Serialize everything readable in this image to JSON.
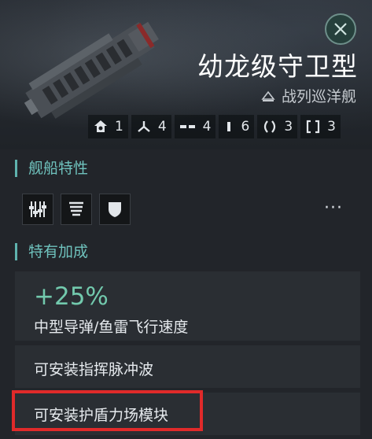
{
  "header": {
    "ship_name": "幼龙级守卫型",
    "ship_class": "战列巡洋舰",
    "close_icon": "close-icon",
    "slots": [
      {
        "icon": "high-slot-icon",
        "value": "1"
      },
      {
        "icon": "turret-icon",
        "value": "4"
      },
      {
        "icon": "launcher-icon",
        "value": "4"
      },
      {
        "icon": "mid-slot-icon",
        "value": "6"
      },
      {
        "icon": "low-slot-icon",
        "value": "3"
      },
      {
        "icon": "rig-slot-icon",
        "value": "3"
      }
    ]
  },
  "traits_section": {
    "title": "舰船特性",
    "traits": [
      "weapons-icon",
      "armor-layers-icon",
      "shield-icon"
    ],
    "more_label": "···"
  },
  "bonus_section": {
    "title": "特有加成",
    "bonus": {
      "percent": "+25%",
      "description": "中型导弹/鱼雷飞行速度"
    },
    "items": [
      "可安装指挥脉冲波",
      "可安装护盾力场模块"
    ]
  },
  "colors": {
    "accent": "#6fc2bd",
    "highlight": "#e02a2a",
    "bonus_value": "#72c9ad"
  }
}
